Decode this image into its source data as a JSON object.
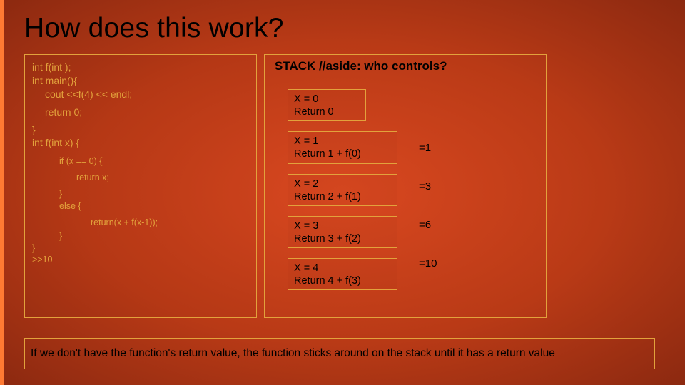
{
  "title": "How does this work?",
  "code": {
    "l0": "int f(int );",
    "l1": "int main(){",
    "l2": "cout <<f(4) << endl;",
    "l3": "return 0;",
    "l4": "}",
    "l5": "int f(int x) {",
    "l6": "if (x == 0) {",
    "l7": "return x;",
    "l8": "}",
    "l9": "else {",
    "l10": "return(x + f(x-1));",
    "l11": "}",
    "l12": "}",
    "l13": ">>10"
  },
  "stack": {
    "heading_bold": "STACK",
    "heading_rest": " //aside: who controls?",
    "frames": [
      {
        "line1": "X = 0",
        "line2": "Return 0"
      },
      {
        "line1": "X = 1",
        "line2": "Return 1 + f(0)"
      },
      {
        "line1": "X = 2",
        "line2": "Return 2 + f(1)"
      },
      {
        "line1": "X = 3",
        "line2": "Return  3 + f(2)"
      },
      {
        "line1": "X = 4",
        "line2": "Return  4 + f(3)"
      }
    ],
    "results": [
      "=1",
      "=3",
      "=6",
      "=10"
    ]
  },
  "footer": "If we don't have the function's return value, the function sticks around on the stack until it has a return value"
}
